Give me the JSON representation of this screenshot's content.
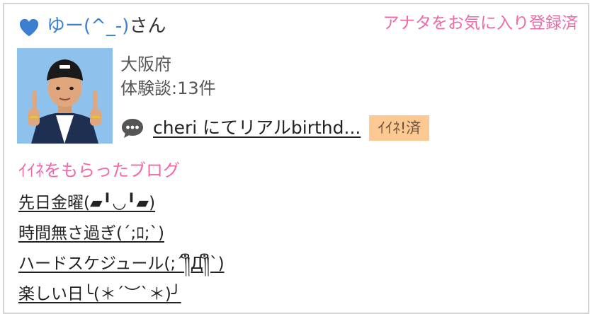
{
  "header": {
    "username": "ゆー(^_-)",
    "honorific": "さん",
    "favorite_status": "アナタをお気に入り登録済",
    "heart_color": "#3a7fd0",
    "accent_pink": "#f068a8"
  },
  "profile": {
    "location": "大阪府",
    "review_count": "体験談:13件",
    "latest_review": "cheri にてリアルbirthd...",
    "like_badge": "ｲｲﾈ!済",
    "badge_color": "#fdc992"
  },
  "liked_blogs": {
    "title": "ｲｲﾈをもらったブログ",
    "items": [
      {
        "label": "先日金曜(▰╹◡╹▰)"
      },
      {
        "label": "時間無さ過ぎ(´;ﾛ;`)"
      },
      {
        "label": "ハードスケジュール(;´༎ຶД༎ຶ`)"
      },
      {
        "label": "楽しい日╰(＊´︶`＊)╯"
      }
    ]
  }
}
